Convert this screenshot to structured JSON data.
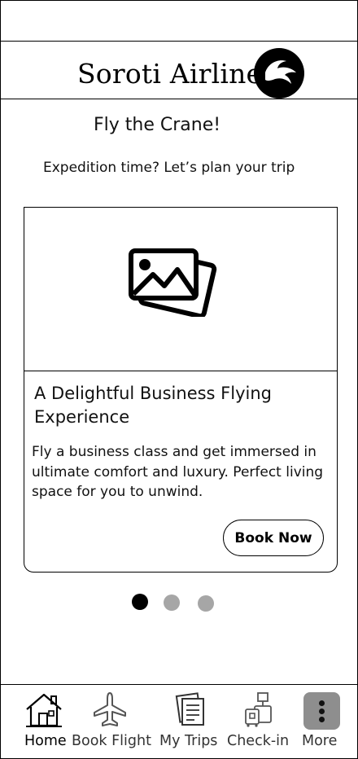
{
  "header": {
    "brand_name": "Soroti Airlines",
    "logo_icon": "crane-logo-icon"
  },
  "hero": {
    "greeting": "Fly the Crane!",
    "subtitle": "Expedition time? Let’s plan your trip"
  },
  "card": {
    "image_icon": "image-placeholder-icon",
    "title": "A Delightful Business Flying Experience",
    "description": "Fly a business class and get immersed in ultimate comfort and luxury. Perfect living space for you to unwind.",
    "button_label": "Book Now"
  },
  "carousel": {
    "total_slides": 3,
    "active_slide": 1
  },
  "tabs": [
    {
      "label": "Home",
      "icon": "home-icon",
      "active": true
    },
    {
      "label": "Book Flight",
      "icon": "airplane-icon",
      "active": false
    },
    {
      "label": "My Trips",
      "icon": "documents-icon",
      "active": false
    },
    {
      "label": "Check-in",
      "icon": "luggage-icon",
      "active": false
    },
    {
      "label": "More",
      "icon": "more-vertical-icon",
      "active": false
    }
  ],
  "colors": {
    "background": "#ffffff",
    "text": "#111111",
    "inactive_dot": "#a6a6a6",
    "more_button": "#8e8e8e"
  }
}
